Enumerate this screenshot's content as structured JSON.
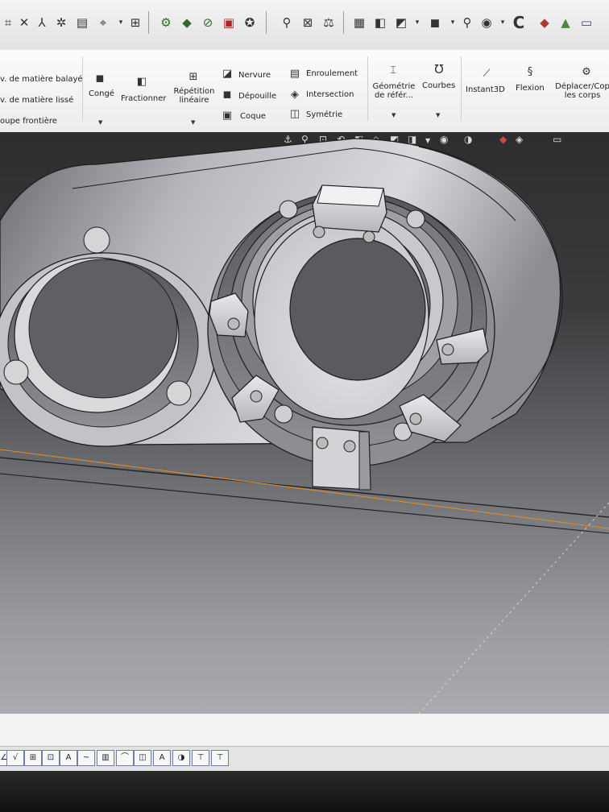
{
  "toolbar": {
    "icons": [
      "sketch-icon",
      "smart-dimension-icon",
      "relation-icon",
      "trim-icon",
      "offset-icon",
      "arrow-down-icon",
      "repair-icon",
      "rotate-icon",
      "check-icon",
      "mate-icon",
      "toggle-icon",
      "search-icon",
      "measure-icon",
      "image-icon",
      "folder-icon",
      "cube-icon",
      "zoom-icon",
      "eye-icon",
      "rebuild-icon",
      "appearance-icon",
      "scene-icon",
      "monitor-icon"
    ]
  },
  "ribbon": {
    "swept_cut": "v. de matière balayé",
    "lofted_cut": "v. de matière lissé",
    "boundary_cut": "oupe frontière",
    "fillet": "Congé",
    "split": "Fractionner",
    "linear_pattern": "Répétition\nlinéaire",
    "rib": "Nervure",
    "draft": "Dépouille",
    "shell": "Coque",
    "wrap": "Enroulement",
    "intersect": "Intersection",
    "mirror": "Symétrie",
    "ref_geometry": "Géométrie\nde référ...",
    "curves": "Courbes",
    "instant3d": "Instant3D",
    "flex": "Flexion",
    "move_bodies": "Déplacer/Cop\nles corps"
  },
  "colors": {
    "viewport_top": "#2e2e2f",
    "viewport_bottom": "#a9abaf",
    "model_face": "#d9d9dc",
    "edge": "#1d1d1f",
    "accent_line": "#e08a2e"
  }
}
